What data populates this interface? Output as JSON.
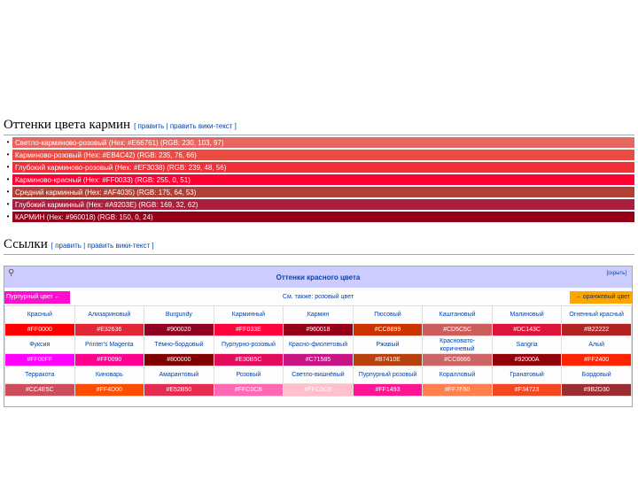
{
  "section1": {
    "title": "Оттенки цвета кармин",
    "edit_label": "[ править | править вики-текст ]",
    "swatches": [
      {
        "text": "Светло-карминово-розовый (Hex: #E66761) (RGB: 230, 103, 97)",
        "color": "#e66761"
      },
      {
        "text": "Карминово-розовый (Hex: #EB4C42) (RGB: 235, 76, 66)",
        "color": "#eb4c42"
      },
      {
        "text": "Глубокий карминово-розовый (Hex: #EF3038) (RGB: 239, 48, 56)",
        "color": "#ef3038"
      },
      {
        "text": "Карминово-красный (Hex: #FF0033) (RGB: 255, 0, 51)",
        "color": "#ff0033"
      },
      {
        "text": "Средний карминный (Hex: #AF4035) (RGB: 175, 64, 53)",
        "color": "#af4035"
      },
      {
        "text": "Глубокий карминный (Hex: #A9203E) (RGB: 169, 32, 62)",
        "color": "#a9203e"
      },
      {
        "text": "КАРМИН (Hex: #960018) (RGB: 150, 0, 24)",
        "color": "#960018"
      }
    ]
  },
  "section2": {
    "title": "Ссылки",
    "edit_label": "[ править | править вики-текст ]"
  },
  "navbox": {
    "title": "Оттенки красного цвета",
    "edit_label": "[скрыть]",
    "see_left": "Пурпурный цвет ←",
    "see_center": "См. также: розовый цвет",
    "see_right": "→ оранжевый цвет",
    "rows": [
      {
        "names": [
          "Красный",
          "Ализариновый",
          "Burgundy",
          "Карминный",
          "Кармин",
          "Пюсовый",
          "Каштановый",
          "Малиновый",
          "Огненный красный"
        ],
        "hexes": [
          "#FF0000",
          "#E32636",
          "#900020",
          "#FF033E",
          "#960018",
          "#CC8899",
          "#CD5C5C",
          "#DC143C",
          "#B22222"
        ],
        "colors": [
          "#ff0000",
          "#e32636",
          "#900020",
          "#ff033e",
          "#960018",
          "#cc3300",
          "#cd5c5c",
          "#dc143c",
          "#b22222"
        ]
      },
      {
        "names": [
          "Фуксия",
          "Printer's Magenta",
          "Тёмно-бордовый",
          "Пурпурно-розовый",
          "Красно-фиолетовый",
          "Ржавый",
          "Красновато-коричневый",
          "Sangria",
          "Алый"
        ],
        "hexes": [
          "#FF00FF",
          "#FF0090",
          "#800000",
          "#E30B5C",
          "#C71585",
          "#B7410E",
          "#CC6666",
          "#92000A",
          "#FF2400"
        ],
        "colors": [
          "#ff00ff",
          "#ff0090",
          "#800000",
          "#e30b5c",
          "#c71585",
          "#b7410e",
          "#cc6666",
          "#92000a",
          "#ff2400"
        ]
      },
      {
        "names": [
          "Терракота",
          "Киноварь",
          "Амарантовый",
          "Розовый",
          "Светло-вишнёвый",
          "Пурпурный розовый",
          "Коралловый",
          "Гранатовый",
          "Бордовый"
        ],
        "hexes": [
          "#CC4E5C",
          "#FF4D00",
          "#E52B50",
          "#FFC0CB",
          "#FFC0CB",
          "#FF1493",
          "#FF7F50",
          "#F34723",
          "#9B2D30"
        ],
        "colors": [
          "#cc4e5c",
          "#ff4d00",
          "#e52b50",
          "#ff69b4",
          "#ffc0cb",
          "#ff1493",
          "#ff7f50",
          "#f34723",
          "#9b2d30"
        ]
      }
    ]
  }
}
